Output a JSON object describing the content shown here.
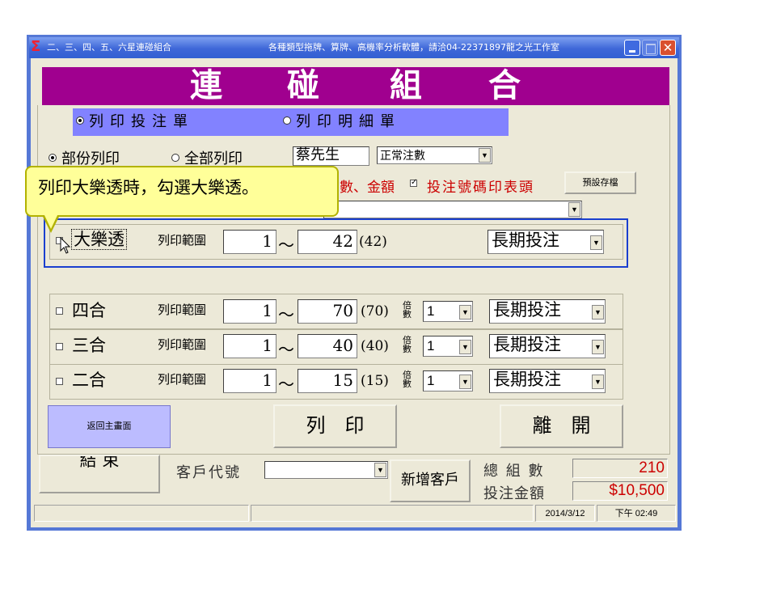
{
  "window": {
    "title": "二、三、四、五、六星連碰組合",
    "title_ad": "各種類型拖牌、算牌、高機率分析軟體，請洽04-22371897龍之光工作室"
  },
  "banner": [
    "連",
    "碰",
    "組",
    "合"
  ],
  "print_tabs": {
    "print_ticket": "列印投注單",
    "print_detail": "列印明細單"
  },
  "print_scope": {
    "partial": "部份列印",
    "all": "全部列印"
  },
  "client_name": "蔡先生",
  "note_type": "正常注數",
  "options_text": "數、金額",
  "option_print_header": "投注號碼印表頭",
  "default_save_button": "預設存檔",
  "tooltip": "列印大樂透時，勾選大樂透。",
  "lotto_rows": [
    {
      "name": "大樂透",
      "range_label": "列印範圍",
      "from": "1",
      "to": "42",
      "total": "(42)",
      "multiplier": "",
      "mode": "長期投注"
    },
    {
      "name": "四合",
      "range_label": "列印範圍",
      "from": "1",
      "to": "70",
      "total": "(70)",
      "multiplier": "1",
      "mode": "長期投注"
    },
    {
      "name": "三合",
      "range_label": "列印範圍",
      "from": "1",
      "to": "40",
      "total": "(40)",
      "multiplier": "1",
      "mode": "長期投注"
    },
    {
      "name": "二合",
      "range_label": "列印範圍",
      "from": "1",
      "to": "15",
      "total": "(15)",
      "multiplier": "1",
      "mode": "長期投注"
    }
  ],
  "tilde": "～",
  "multiplier_label": "倍數",
  "buttons": {
    "back_main": "返回主畫面",
    "print": "列　印",
    "leave": "離　開",
    "finish": "結 束",
    "add_customer": "新增客戶"
  },
  "customer_code_label": "客戶代號",
  "totals": {
    "total_groups_label": "總 組 數",
    "total_groups_value": "210",
    "bet_amount_label": "投注金額",
    "bet_amount_value": "$10,500"
  },
  "status": {
    "date": "2014/3/12",
    "time": "下午 02:49"
  },
  "colors": {
    "banner": "#a0008f",
    "tab_bar": "#8282ff",
    "titlebar": "#3360d2",
    "highlight_border": "#1a3fcf",
    "totals_text": "#cc0000",
    "tooltip": "#ffff99"
  }
}
